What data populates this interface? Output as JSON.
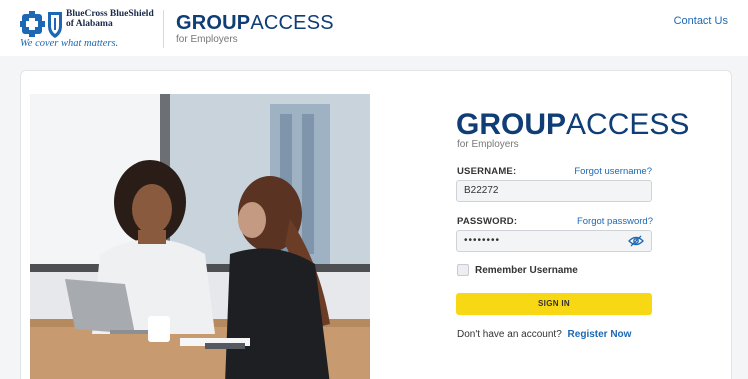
{
  "header": {
    "brand_name_line1": "BlueCross BlueShield",
    "brand_name_line2": "of Alabama",
    "tagline": "We cover what matters.",
    "product_bold": "GROUP",
    "product_light": "ACCESS",
    "product_sub": "for Employers",
    "contact_label": "Contact Us"
  },
  "login": {
    "title_bold": "GROUP",
    "title_light": "ACCESS",
    "subtitle": "for Employers",
    "username_label": "USERNAME:",
    "forgot_username": "Forgot username?",
    "username_value": "B22272",
    "password_label": "PASSWORD:",
    "forgot_password": "Forgot password?",
    "password_value": "••••••••",
    "remember_label": "Remember Username",
    "signin_label": "SIGN IN",
    "no_account_text": "Don't have an account?",
    "register_label": "Register Now"
  },
  "colors": {
    "brand_blue": "#0f3d75",
    "link_blue": "#1d68b3",
    "signin_yellow": "#f8d815"
  },
  "icons": [
    "bluecross-logo-icon",
    "blueshield-logo-icon",
    "eye-slash-icon",
    "checkbox-icon"
  ]
}
